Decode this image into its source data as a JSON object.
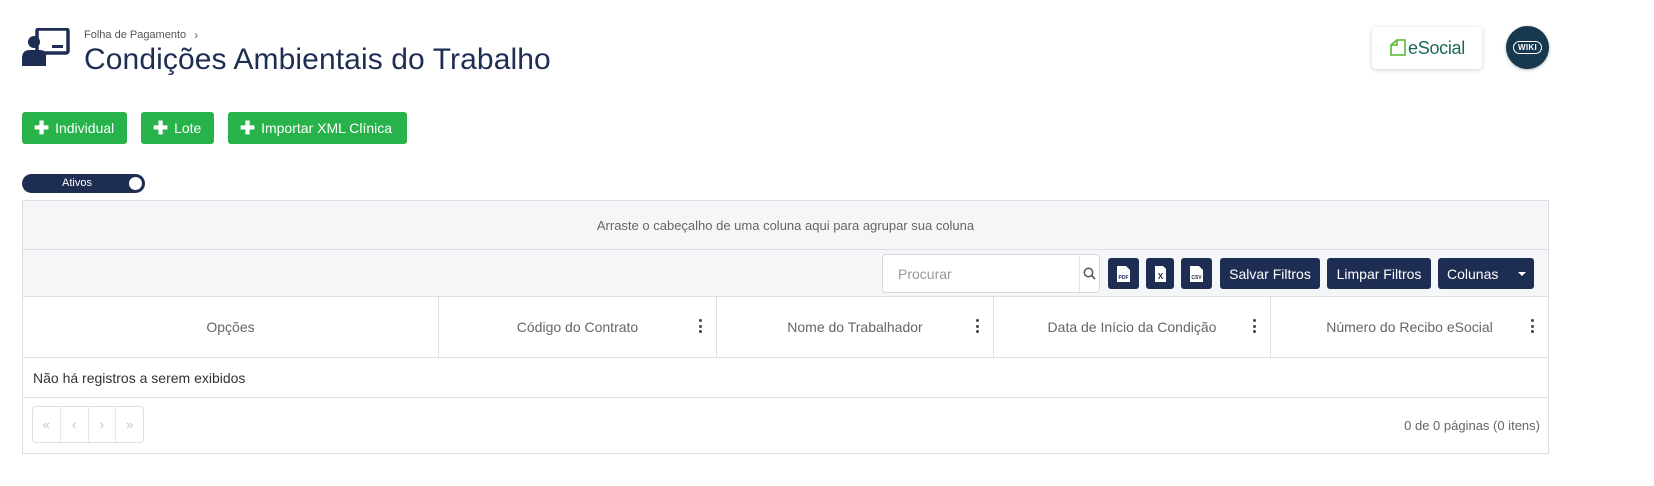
{
  "header": {
    "breadcrumb": "Folha de Pagamento",
    "breadcrumb_sep": "›",
    "title": "Condições Ambientais do Trabalho",
    "esocial_label": "eSocial",
    "wiki_label": "WIKI"
  },
  "actions": {
    "individual": "Individual",
    "lote": "Lote",
    "importar_xml": "Importar XML Clínica"
  },
  "toggle": {
    "label": "Ativos",
    "on": true
  },
  "grid": {
    "group_panel_text": "Arraste o cabeçalho de uma coluna aqui para agrupar sua coluna",
    "search": {
      "placeholder": "Procurar",
      "value": ""
    },
    "export_icons": [
      "pdf-icon",
      "excel-icon",
      "csv-icon"
    ],
    "export_icon_labels": {
      "pdf": "PDF",
      "excel": "X",
      "csv": "CSV"
    },
    "save_filters": "Salvar Filtros",
    "clear_filters": "Limpar Filtros",
    "columns_label": "Colunas",
    "columns": [
      {
        "label": "Opções",
        "menu": false
      },
      {
        "label": "Código do Contrato",
        "menu": true
      },
      {
        "label": "Nome do Trabalhador",
        "menu": true
      },
      {
        "label": "Data de Início da Condição",
        "menu": true
      },
      {
        "label": "Número do Recibo eSocial",
        "menu": true
      }
    ],
    "empty_text": "Não há registros a serem exibidos",
    "pager": {
      "first": "«",
      "prev": "‹",
      "next": "›",
      "last": "»"
    },
    "pager_info": "0 de 0 páginas (0 itens)"
  },
  "colors": {
    "primary": "#1e2d52",
    "success": "#27b24a",
    "wiki": "#16394f",
    "esocial_green": "#1b6a5a"
  }
}
